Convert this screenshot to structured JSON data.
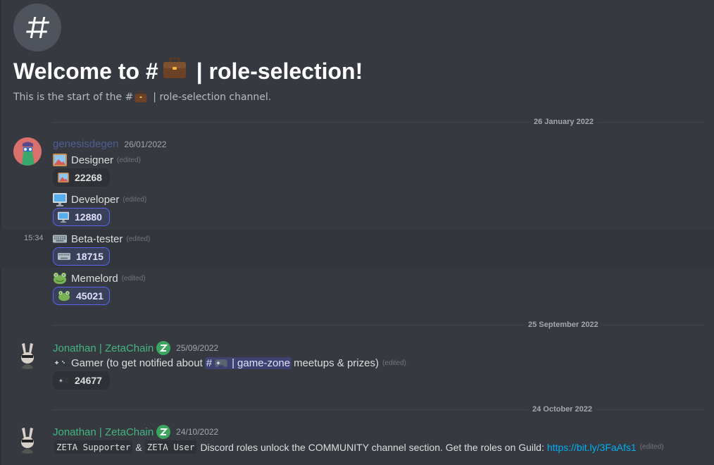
{
  "channel": {
    "welcome_prefix": "Welcome to #",
    "welcome_suffix": "| role-selection!",
    "sub_prefix": "This is the start of the #",
    "sub_suffix": "| role-selection channel."
  },
  "dividers": [
    "26 January 2022",
    "25 September 2022",
    "24 October 2022"
  ],
  "messages": [
    {
      "author": "genesisdegen",
      "author_color": "#4e5d94",
      "timestamp": "26/01/2022",
      "hover_time": "15:34",
      "roles": [
        {
          "label": "Designer",
          "edited": "(edited)",
          "icon": "framed-picture-icon",
          "count": "22268"
        },
        {
          "label": "Developer",
          "edited": "(edited)",
          "icon": "desktop-computer-icon",
          "count": "12880"
        },
        {
          "label": "Beta-tester",
          "edited": "(edited)",
          "icon": "keyboard-icon",
          "count": "18715"
        },
        {
          "label": "Memelord",
          "edited": "(edited)",
          "icon": "frog-icon",
          "count": "45021"
        }
      ]
    },
    {
      "author": "Jonathan | ZetaChain",
      "author_color": "#43b581",
      "timestamp": "25/09/2022",
      "text_pre": "Gamer (to get notified about",
      "mention": "game-zone",
      "text_post": "meetups & prizes)",
      "edited": "(edited)",
      "icon": "video-game-icon",
      "count": "24677"
    },
    {
      "author": "Jonathan | ZetaChain",
      "author_color": "#43b581",
      "timestamp": "24/10/2022",
      "code1": "ZETA Supporter",
      "amp": "&",
      "code2": "ZETA User",
      "text": "Discord roles unlock the COMMUNITY channel section. Get the roles on Guild:",
      "link": "https://bit.ly/3FaAfs1",
      "edited": "(edited)"
    }
  ]
}
